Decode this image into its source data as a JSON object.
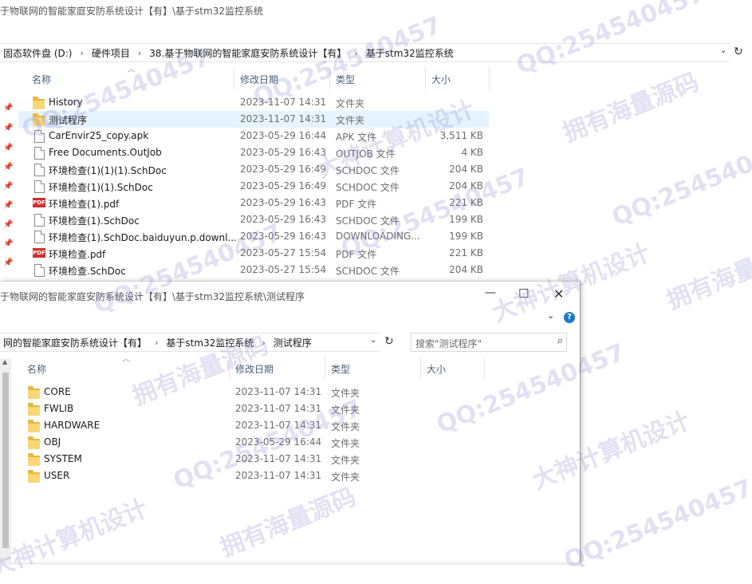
{
  "window1": {
    "title": "于物联网的智能家庭安防系统设计【有】\\基于stm32监控系统",
    "breadcrumbs": [
      "固态软件盘 (D:)",
      "硬件项目",
      "38.基于物联网的智能家庭安防系统设计【有】",
      "基于stm32监控系统"
    ],
    "columns": {
      "name": "名称",
      "date": "修改日期",
      "type": "类型",
      "size": "大小"
    },
    "files": [
      {
        "icon": "folder-icon",
        "name": "History",
        "date": "2023-11-07 14:31",
        "type": "文件夹",
        "size": ""
      },
      {
        "icon": "folder-icon",
        "name": "测试程序",
        "date": "2023-11-07 14:31",
        "type": "文件夹",
        "size": "",
        "selected": true
      },
      {
        "icon": "file-icon",
        "name": "CarEnvir25_copy.apk",
        "date": "2023-05-29 16:44",
        "type": "APK 文件",
        "size": "3,511 KB"
      },
      {
        "icon": "file-icon",
        "name": "Free Documents.OutJob",
        "date": "2023-05-29 16:43",
        "type": "OUTJOB 文件",
        "size": "4 KB"
      },
      {
        "icon": "file-icon",
        "name": "环境检查(1)(1)(1).SchDoc",
        "date": "2023-05-29 16:49",
        "type": "SCHDOC 文件",
        "size": "204 KB"
      },
      {
        "icon": "file-icon",
        "name": "环境检查(1)(1).SchDoc",
        "date": "2023-05-29 16:49",
        "type": "SCHDOC 文件",
        "size": "204 KB"
      },
      {
        "icon": "pdf-icon",
        "name": "环境检查(1).pdf",
        "date": "2023-05-29 16:43",
        "type": "PDF 文件",
        "size": "221 KB"
      },
      {
        "icon": "file-icon",
        "name": "环境检查(1).SchDoc",
        "date": "2023-05-29 16:43",
        "type": "SCHDOC 文件",
        "size": "199 KB"
      },
      {
        "icon": "file-icon",
        "name": "环境检查(1).SchDoc.baiduyun.p.downl...",
        "date": "2023-05-29 16:43",
        "type": "DOWNLOADING...",
        "size": "199 KB"
      },
      {
        "icon": "pdf-icon",
        "name": "环境检查.pdf",
        "date": "2023-05-27 15:54",
        "type": "PDF 文件",
        "size": "221 KB"
      },
      {
        "icon": "file-icon",
        "name": "环境检查.SchDoc",
        "date": "2023-05-27 15:54",
        "type": "SCHDOC 文件",
        "size": "204 KB"
      }
    ]
  },
  "window2": {
    "title": "于物联网的智能家庭安防系统设计【有】\\基于stm32监控系统\\测试程序",
    "breadcrumbs": [
      "网的智能家庭安防系统设计【有】",
      "基于stm32监控系统",
      "测试程序"
    ],
    "search_placeholder": "搜索\"测试程序\"",
    "columns": {
      "name": "名称",
      "date": "修改日期",
      "type": "类型",
      "size": "大小"
    },
    "files": [
      {
        "icon": "folder-icon",
        "name": "CORE",
        "date": "2023-11-07 14:31",
        "type": "文件夹"
      },
      {
        "icon": "folder-icon",
        "name": "FWLIB",
        "date": "2023-11-07 14:31",
        "type": "文件夹"
      },
      {
        "icon": "folder-icon",
        "name": "HARDWARE",
        "date": "2023-11-07 14:31",
        "type": "文件夹"
      },
      {
        "icon": "folder-icon",
        "name": "OBJ",
        "date": "2023-05-29 16:44",
        "type": "文件夹"
      },
      {
        "icon": "folder-icon",
        "name": "SYSTEM",
        "date": "2023-11-07 14:31",
        "type": "文件夹"
      },
      {
        "icon": "folder-icon",
        "name": "USER",
        "date": "2023-11-07 14:31",
        "type": "文件夹"
      }
    ]
  },
  "watermarks": [
    "QQ:254540457",
    "拥有海量源码",
    "大神计算机设计"
  ]
}
